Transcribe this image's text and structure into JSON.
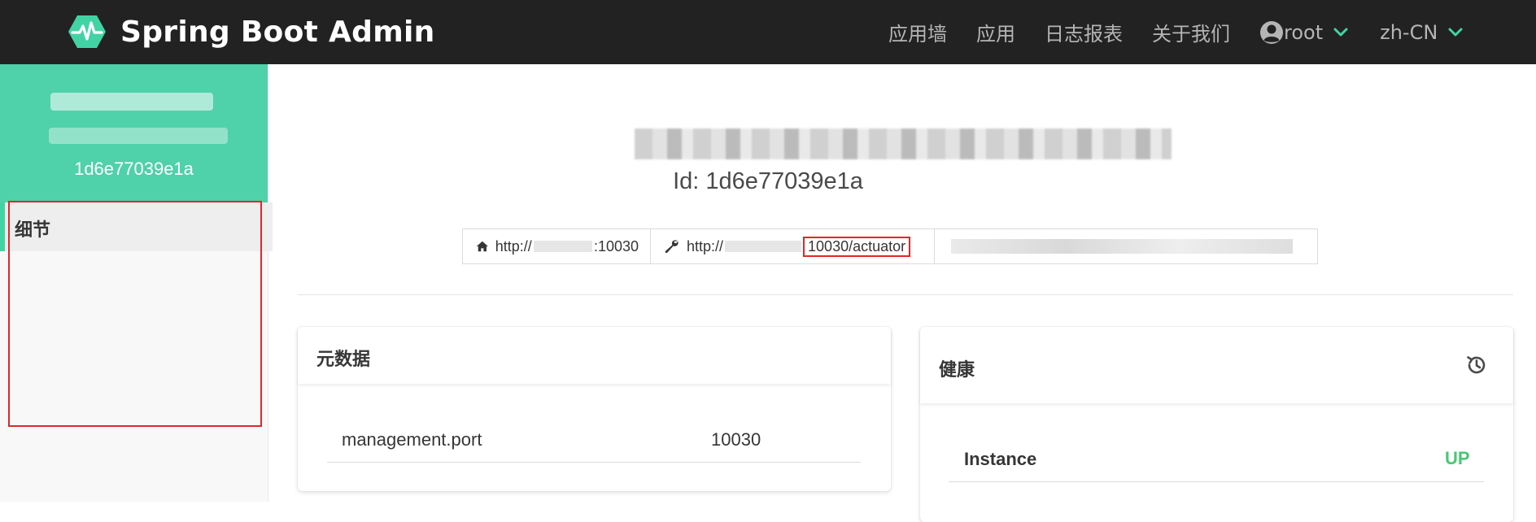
{
  "navbar": {
    "title": "Spring Boot Admin",
    "items": [
      "应用墙",
      "应用",
      "日志报表",
      "关于我们"
    ],
    "user": "root",
    "language": "zh-CN",
    "accent_color": "#42d3a5"
  },
  "sidebar": {
    "instance_id": "1d6e77039e1a",
    "items": [
      {
        "label": "细节",
        "icon": ""
      }
    ]
  },
  "main": {
    "instance_heading": "Id: 1d6e77039e1a",
    "urls": {
      "service_prefix": "http://",
      "service_suffix": ":10030",
      "management_prefix": "http://",
      "management_suffix": "10030/actuator",
      "service_icon": "home-icon",
      "management_icon": "wrench-icon"
    },
    "metadata": {
      "title": "元数据",
      "rows": [
        {
          "key": "management.port",
          "value": "10030"
        }
      ]
    },
    "health": {
      "title": "健康",
      "rows": [
        {
          "key": "Instance",
          "status": "UP"
        }
      ],
      "status_color": "#48c774"
    }
  }
}
